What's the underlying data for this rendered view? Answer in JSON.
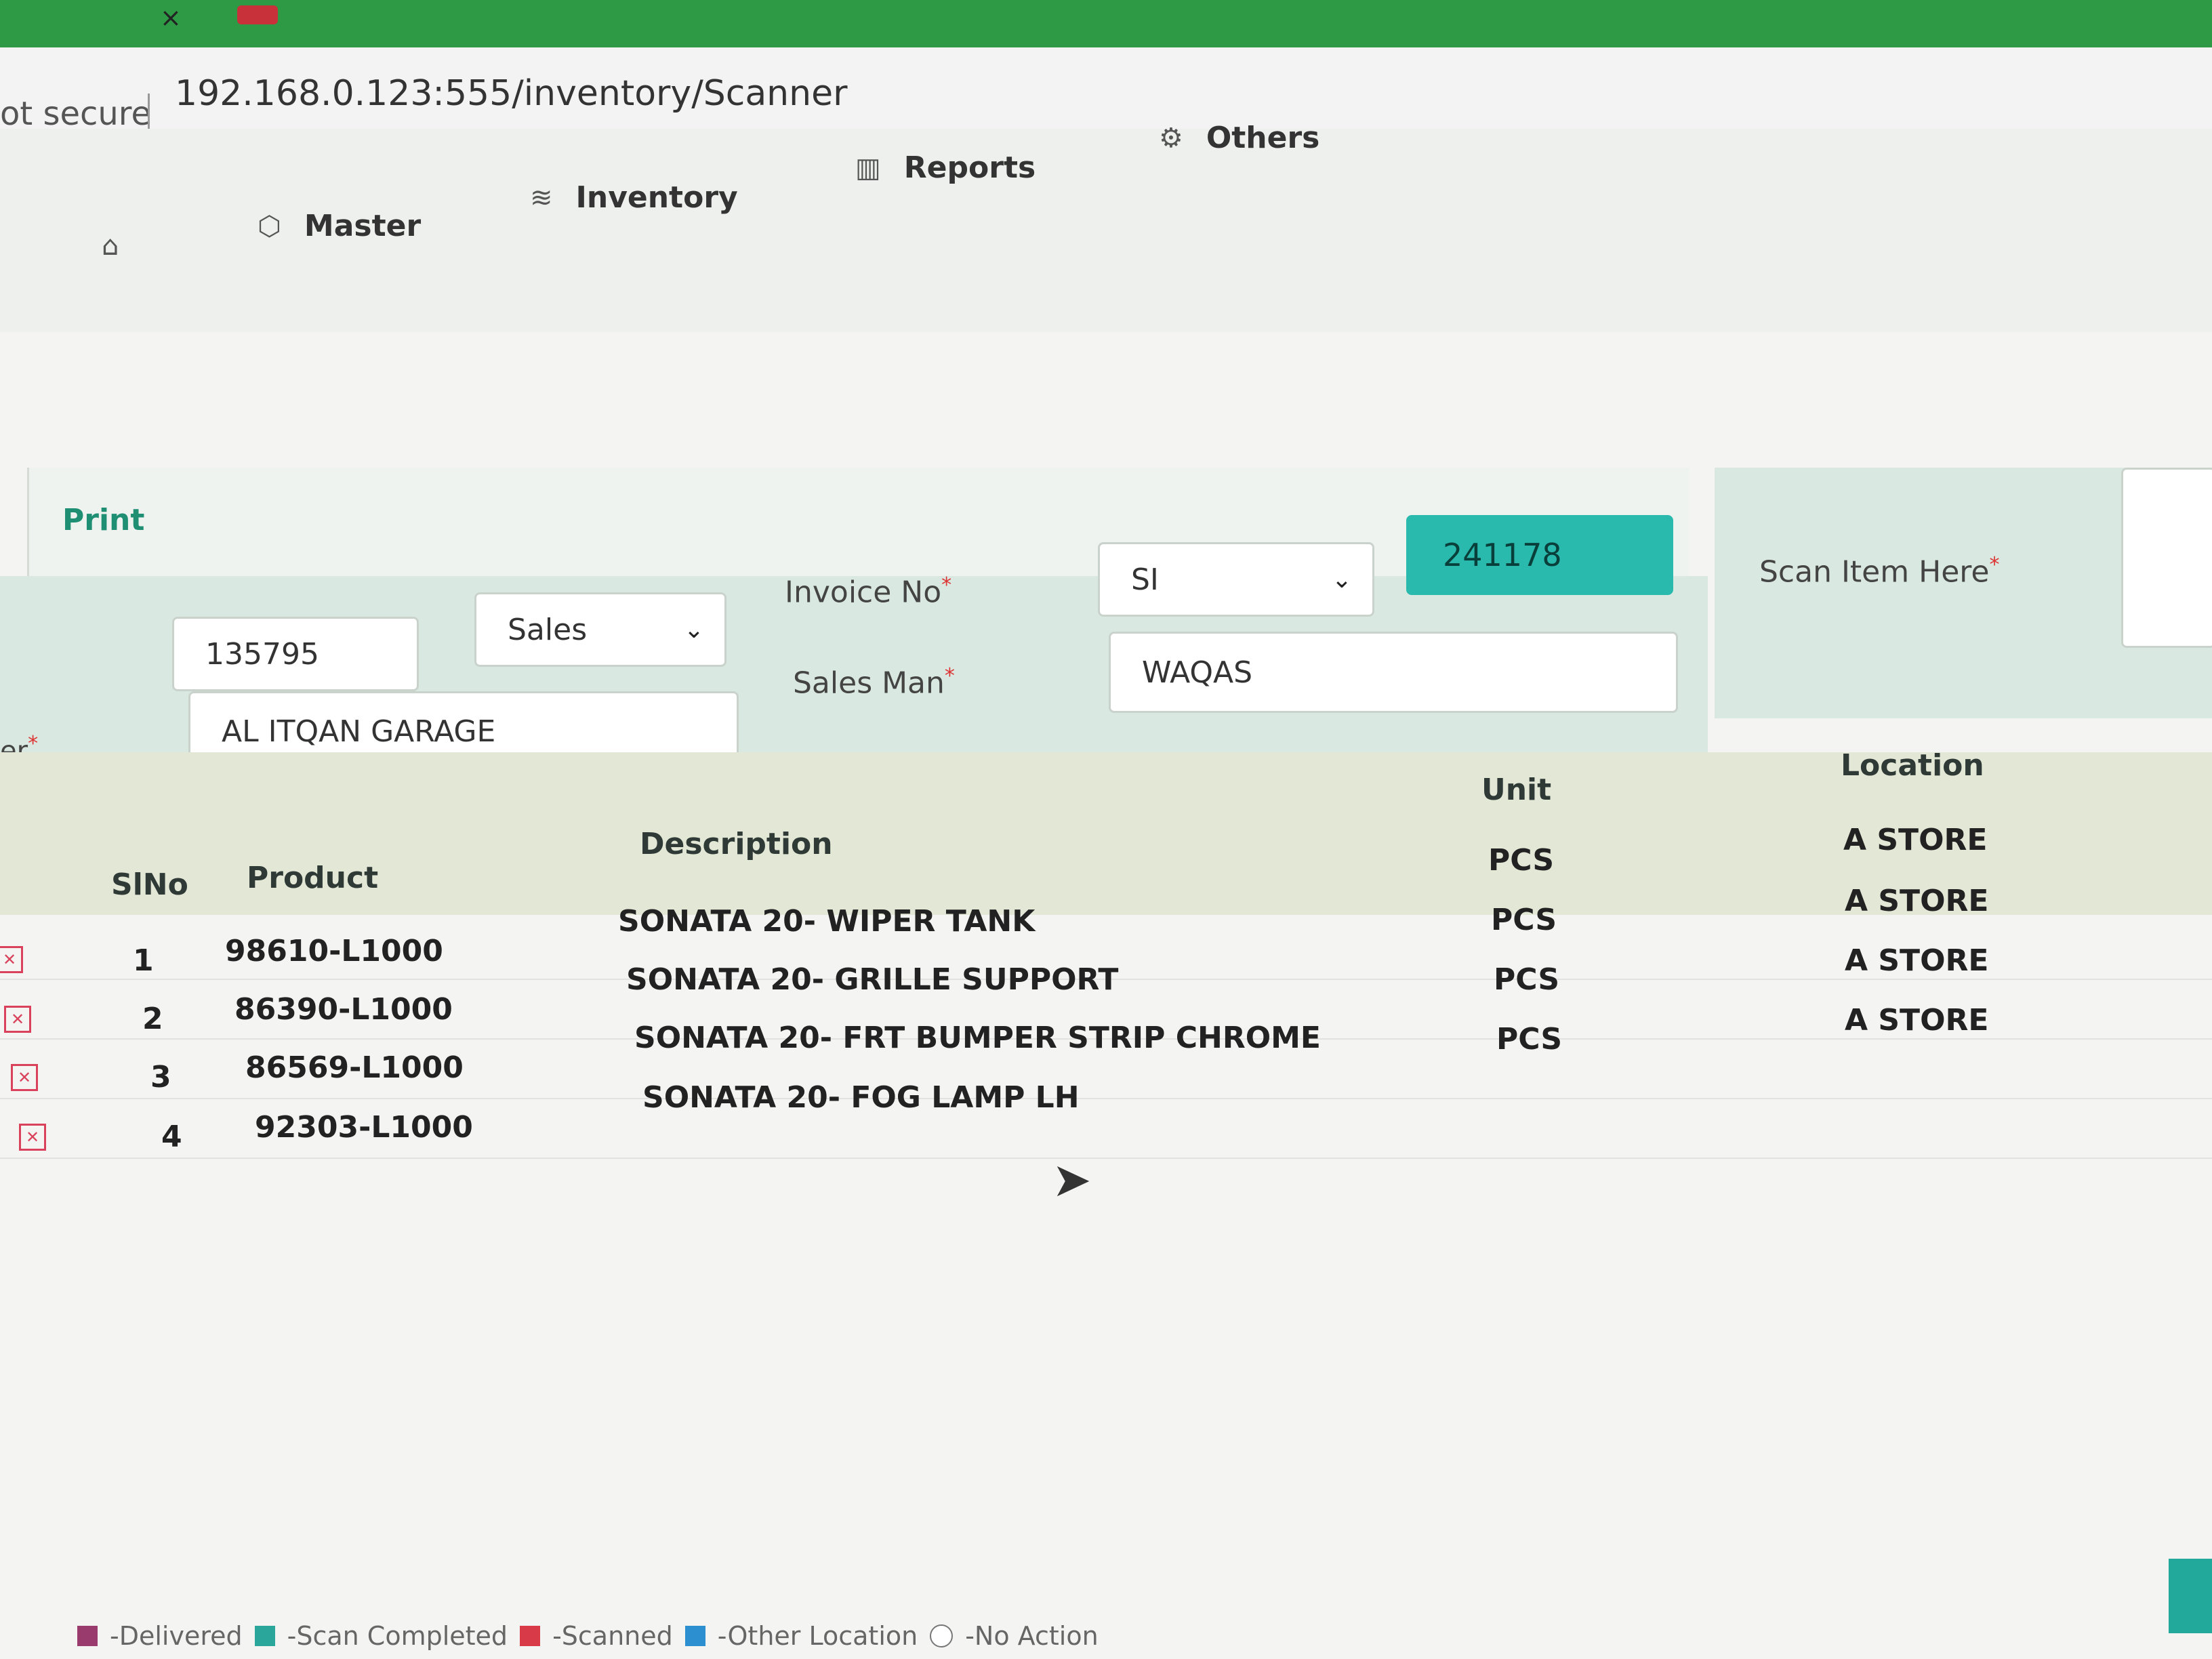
{
  "browser": {
    "tab_close": "×",
    "security_label": "ot secure",
    "url": "192.168.0.123:555/inventory/Scanner"
  },
  "nav": {
    "home_icon": "⌂",
    "items": [
      {
        "icon": "⬡",
        "label": "Master"
      },
      {
        "icon": "≋",
        "label": "Inventory"
      },
      {
        "icon": "▥",
        "label": "Reports"
      },
      {
        "icon": "⚙",
        "label": "Others"
      }
    ]
  },
  "toolbar": {
    "print_label": "Print"
  },
  "form": {
    "customer_code": "135795",
    "type_select": "Sales",
    "invoice_label": "Invoice No",
    "invoice_prefix": "SI",
    "invoice_number": "241178",
    "customer_label": "er",
    "customer_name": "AL ITQAN GARAGE",
    "salesman_label": "Sales Man",
    "salesman_value": "WAQAS",
    "scan_label": "Scan Item Here",
    "required_mark": "*",
    "chevron": "⌄"
  },
  "table": {
    "headers": {
      "slno": "SlNo",
      "product": "Product",
      "description": "Description",
      "unit": "Unit",
      "location": "Location"
    },
    "rows": [
      {
        "slno": "1",
        "product": "98610-L1000",
        "description": "SONATA 20- WIPER TANK",
        "unit": "PCS",
        "location": "A STORE"
      },
      {
        "slno": "2",
        "product": "86390-L1000",
        "description": "SONATA 20- GRILLE SUPPORT",
        "unit": "PCS",
        "location": "A STORE"
      },
      {
        "slno": "3",
        "product": "86569-L1000",
        "description": "SONATA 20- FRT BUMPER STRIP CHROME",
        "unit": "PCS",
        "location": "A STORE"
      },
      {
        "slno": "4",
        "product": "92303-L1000",
        "description": "SONATA 20- FOG LAMP LH",
        "unit": "PCS",
        "location": "A STORE"
      }
    ]
  },
  "legend": [
    {
      "label": "-Delivered",
      "color": "#9a3b6e"
    },
    {
      "label": "-Scan Completed",
      "color": "#2aa79a"
    },
    {
      "label": "-Scanned",
      "color": "#d93a47"
    },
    {
      "label": "-Other Location",
      "color": "#2c8fd0"
    },
    {
      "label": "-No Action",
      "color": "#ffffff"
    }
  ],
  "colors": {
    "accent": "#2ab9ad",
    "brand_green": "#2f9a46",
    "link": "#1f8f73"
  }
}
